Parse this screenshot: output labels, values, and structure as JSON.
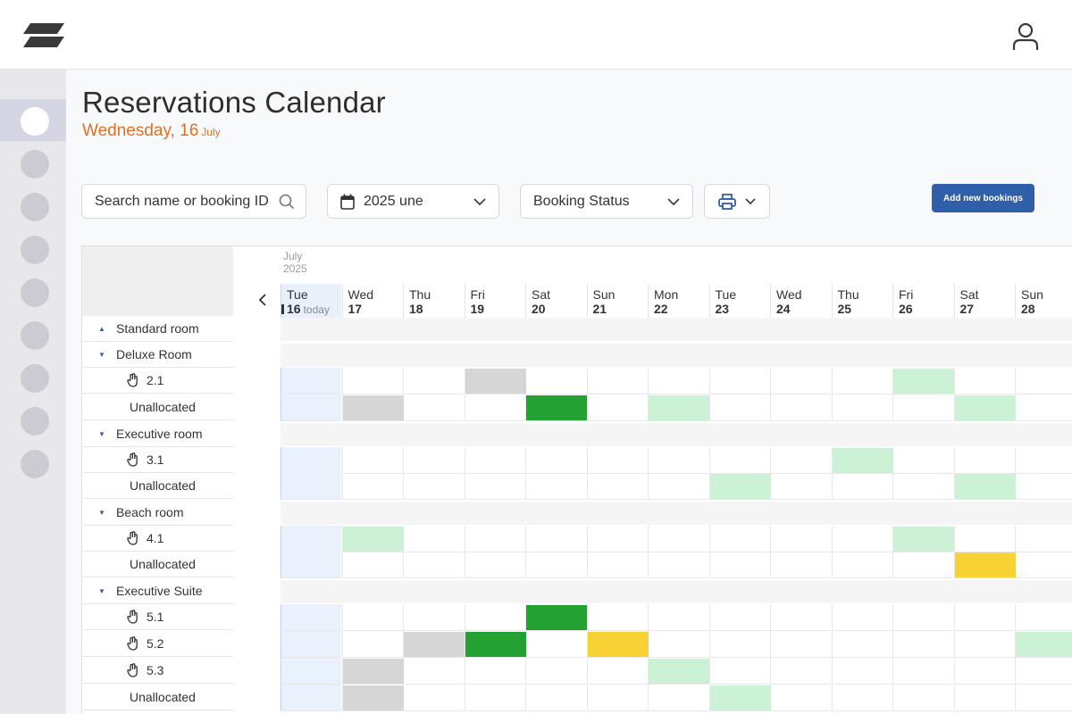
{
  "header": {
    "logo_icon": "layers-logo-icon",
    "user_icon": "user-icon"
  },
  "sidebar": {
    "items": [
      "nav-1",
      "nav-2",
      "nav-3",
      "nav-4",
      "nav-5",
      "nav-6",
      "nav-7",
      "nav-8",
      "nav-9"
    ],
    "active_index": 0
  },
  "page": {
    "title": "Reservations Calendar",
    "date_main": "Wednesday, 16",
    "date_month": "July"
  },
  "toolbar": {
    "search_placeholder": "Search name or booking ID",
    "month_value": "2025 une",
    "status_value": "Booking Status",
    "add_label": "Add new bookings"
  },
  "calendar": {
    "month_label": "July",
    "year_label": "2025",
    "today_label": "today",
    "days": [
      {
        "dow": "Tue",
        "num": "16",
        "today": true
      },
      {
        "dow": "Wed",
        "num": "17"
      },
      {
        "dow": "Thu",
        "num": "18"
      },
      {
        "dow": "Fri",
        "num": "19"
      },
      {
        "dow": "Sat",
        "num": "20"
      },
      {
        "dow": "Sun",
        "num": "21"
      },
      {
        "dow": "Mon",
        "num": "22"
      },
      {
        "dow": "Tue",
        "num": "23"
      },
      {
        "dow": "Wed",
        "num": "24"
      },
      {
        "dow": "Thu",
        "num": "25"
      },
      {
        "dow": "Fri",
        "num": "26"
      },
      {
        "dow": "Sat",
        "num": "27"
      },
      {
        "dow": "Sun",
        "num": "28"
      }
    ],
    "rows": [
      {
        "type": "group",
        "label": "Standard room",
        "caret": "▲"
      },
      {
        "type": "group",
        "label": "Deluxe Room",
        "caret": "▼"
      },
      {
        "type": "room",
        "label": "2.1",
        "bookings": [
          {
            "day": 3,
            "status": "gray"
          },
          {
            "day": 10,
            "status": "light"
          }
        ]
      },
      {
        "type": "unalloc",
        "label": "Unallocated",
        "bookings": [
          {
            "day": 1,
            "status": "gray"
          },
          {
            "day": 4,
            "status": "green"
          },
          {
            "day": 6,
            "status": "light"
          },
          {
            "day": 11,
            "status": "light"
          }
        ]
      },
      {
        "type": "group",
        "label": "Executive room",
        "caret": "▼"
      },
      {
        "type": "room",
        "label": "3.1",
        "bookings": [
          {
            "day": 9,
            "status": "light"
          }
        ]
      },
      {
        "type": "unalloc",
        "label": "Unallocated",
        "bookings": [
          {
            "day": 7,
            "status": "light"
          },
          {
            "day": 11,
            "status": "light"
          }
        ]
      },
      {
        "type": "group",
        "label": "Beach room",
        "caret": "▼"
      },
      {
        "type": "room",
        "label": "4.1",
        "bookings": [
          {
            "day": 1,
            "status": "light"
          },
          {
            "day": 10,
            "status": "light"
          }
        ]
      },
      {
        "type": "unalloc",
        "label": "Unallocated",
        "bookings": [
          {
            "day": 11,
            "status": "yellow"
          }
        ]
      },
      {
        "type": "group",
        "label": "Executive Suite",
        "caret": "▼"
      },
      {
        "type": "room",
        "label": "5.1",
        "bookings": [
          {
            "day": 4,
            "status": "green"
          }
        ]
      },
      {
        "type": "room",
        "label": "5.2",
        "bookings": [
          {
            "day": 2,
            "status": "gray"
          },
          {
            "day": 3,
            "status": "green"
          },
          {
            "day": 5,
            "status": "yellow"
          },
          {
            "day": 12,
            "status": "light"
          }
        ]
      },
      {
        "type": "room",
        "label": "5.3",
        "bookings": [
          {
            "day": 1,
            "status": "gray"
          },
          {
            "day": 6,
            "status": "light"
          }
        ]
      },
      {
        "type": "unalloc",
        "label": "Unallocated",
        "bookings": [
          {
            "day": 1,
            "status": "gray"
          },
          {
            "day": 7,
            "status": "light"
          }
        ]
      }
    ],
    "status_colors": {
      "gray": "#d6d6d6",
      "green": "#23a132",
      "light": "#ccf2d6",
      "yellow": "#f7d235"
    }
  }
}
